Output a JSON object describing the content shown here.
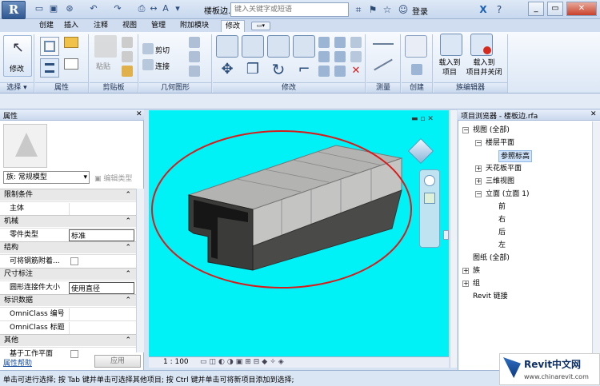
{
  "app": {
    "logo": "R",
    "doc_title": "楼板边.rfa - 三...",
    "search_placeholder": "键入关键字或短语",
    "login": "登录"
  },
  "tabs": [
    "创建",
    "插入",
    "注释",
    "视图",
    "管理",
    "附加模块",
    "修改"
  ],
  "active_tab": "修改",
  "ribbon": {
    "modify_label": "修改",
    "select_label": "选择 ▾",
    "properties_label": "属性",
    "clipboard": {
      "paste": "粘贴",
      "label": "剪贴板"
    },
    "geometry": {
      "cut": "剪切",
      "join": "连接",
      "label": "几何图形"
    },
    "modify_panel_label": "修改",
    "measure_label": "测量",
    "create_label": "创建",
    "family_editor": {
      "load_into_project": "载入到\n项目",
      "load_close": "载入到\n项目并关闭",
      "label": "族编辑器"
    }
  },
  "properties": {
    "title": "属性",
    "family_selector": "族: 常规模型",
    "edit_type": "编辑类型",
    "groups": [
      {
        "name": "限制条件",
        "rows": [
          {
            "key": "主体",
            "value": ""
          }
        ]
      },
      {
        "name": "机械",
        "rows": [
          {
            "key": "零件类型",
            "value": "标准"
          }
        ]
      },
      {
        "name": "结构",
        "rows": [
          {
            "key": "可将钢筋附着...",
            "value": "",
            "checkbox": true
          }
        ]
      },
      {
        "name": "尺寸标注",
        "rows": [
          {
            "key": "圆形连接件大小",
            "value": "使用直径"
          }
        ]
      },
      {
        "name": "标识数据",
        "rows": [
          {
            "key": "OmniClass 编号",
            "value": ""
          },
          {
            "key": "OmniClass 标题",
            "value": ""
          }
        ]
      },
      {
        "name": "其他",
        "rows": [
          {
            "key": "基于工作平面",
            "value": "",
            "checkbox": true
          }
        ]
      }
    ],
    "help": "属性帮助",
    "apply": "应用"
  },
  "viewport": {
    "scale": "1 : 100",
    "bg_color": "#00f2f7"
  },
  "browser": {
    "title": "项目浏览器 - 楼板边.rfa",
    "nodes": [
      {
        "label": "视图 (全部)",
        "level": 0,
        "toggle": "−"
      },
      {
        "label": "楼层平面",
        "level": 1,
        "toggle": "−"
      },
      {
        "label": "参照标高",
        "level": 2,
        "selected": true
      },
      {
        "label": "天花板平面",
        "level": 1,
        "toggle": "+"
      },
      {
        "label": "三维视图",
        "level": 1,
        "toggle": "+"
      },
      {
        "label": "立面 (立面 1)",
        "level": 1,
        "toggle": "−"
      },
      {
        "label": "前",
        "level": 2
      },
      {
        "label": "右",
        "level": 2
      },
      {
        "label": "后",
        "level": 2
      },
      {
        "label": "左",
        "level": 2
      },
      {
        "label": "图纸 (全部)",
        "level": 0
      },
      {
        "label": "族",
        "level": 0,
        "toggle": "+"
      },
      {
        "label": "组",
        "level": 0,
        "toggle": "+"
      },
      {
        "label": "Revit 链接",
        "level": 0
      }
    ]
  },
  "status": "单击可进行选择; 按 Tab 键并单击可选择其他项目; 按 Ctrl 键并单击可将新项目添加到选择;",
  "watermark": {
    "brand": "Revit中文网",
    "url": "www.chinarevit.com"
  }
}
